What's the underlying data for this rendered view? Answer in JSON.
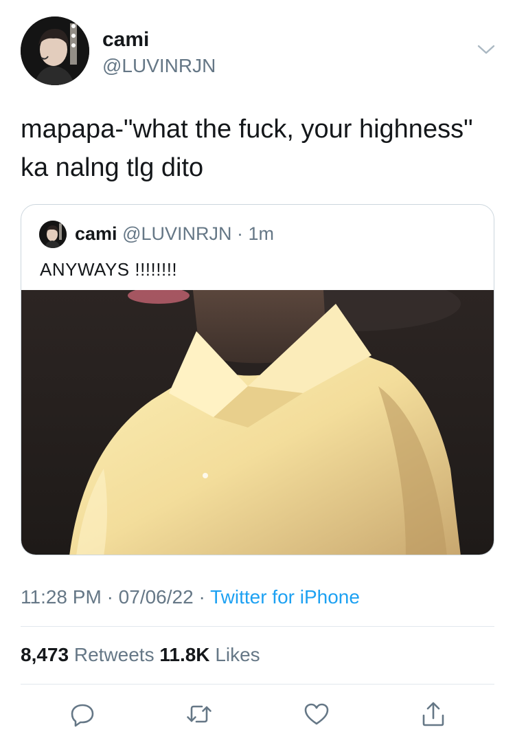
{
  "author": {
    "name": "cami",
    "handle": "@LUVINRJN"
  },
  "tweet": {
    "text": "mapapa-\"what the fuck, your highness\" ka nalng tlg dito"
  },
  "quoted_tweet": {
    "name": "cami",
    "handle": "@LUVINRJN",
    "separator": "·",
    "time": "1m",
    "text": "ANYWAYS !!!!!!!!"
  },
  "meta": {
    "time": "11:28 PM",
    "sep1": "·",
    "date": "07/06/22",
    "sep2": "·",
    "source": "Twitter for iPhone"
  },
  "stats": {
    "retweets_count": "8,473",
    "retweets_label": "Retweets",
    "likes_count": "11.8K",
    "likes_label": "Likes"
  },
  "icons": {
    "reply": "reply-icon",
    "retweet": "retweet-icon",
    "like": "like-icon",
    "share": "share-icon",
    "more": "chevron-down-icon"
  },
  "colors": {
    "text": "#14171a",
    "secondary": "#657786",
    "accent": "#1da1f2",
    "border": "#e1e8ed"
  }
}
